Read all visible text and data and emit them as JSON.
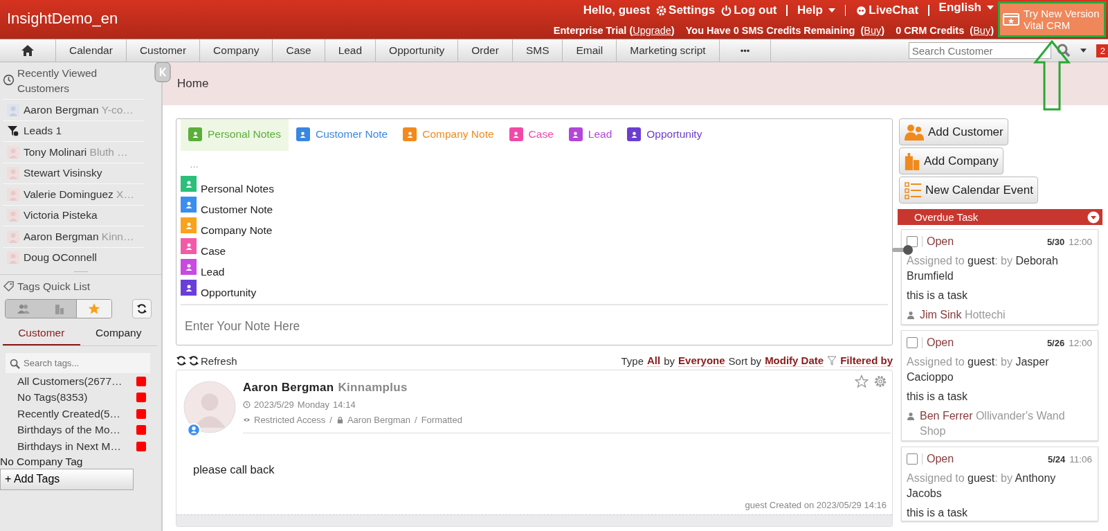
{
  "header": {
    "brand": "InsightDemo_en",
    "greeting": "Hello, guest",
    "settings": "Settings",
    "logout": "Log out",
    "help": "Help",
    "livechat": "LiveChat",
    "language": "English",
    "trial_segments": [
      {
        "kind": "text",
        "text": "Enterprise Trial ("
      },
      {
        "kind": "link",
        "text": "Upgrade"
      },
      {
        "kind": "text",
        "text": ")"
      }
    ],
    "sms_segments": [
      {
        "kind": "text",
        "text": "You Have 0 SMS Credits Remaining"
      },
      {
        "kind": "text",
        "text": "("
      },
      {
        "kind": "link",
        "text": "Buy"
      },
      {
        "kind": "text",
        "text": ")"
      }
    ],
    "crm_segments": [
      {
        "kind": "text",
        "text": "0 CRM Credits"
      },
      {
        "kind": "text",
        "text": "("
      },
      {
        "kind": "link",
        "text": "Buy"
      },
      {
        "kind": "text",
        "text": ")"
      }
    ],
    "try_button": {
      "line1": "Try New Version",
      "line2": "Vital CRM"
    }
  },
  "nav": {
    "items": [
      "Calendar",
      "Customer",
      "Company",
      "Case",
      "Lead",
      "Opportunity",
      "Order",
      "SMS",
      "Email",
      "Marketing script"
    ],
    "more": "•••",
    "search": {
      "placeholder": "Search Customer"
    },
    "badge": "2"
  },
  "sidebar": {
    "recent_title": "Recently Viewed Customers",
    "recent": [
      {
        "kind": "customer",
        "name": "Aaron Bergman",
        "company": "Y-co…"
      },
      {
        "kind": "lead",
        "name": "Leads 1"
      },
      {
        "kind": "customer",
        "name": "Tony Molinari",
        "company": "Bluth …"
      },
      {
        "kind": "customer",
        "name": "Stewart Visinsky"
      },
      {
        "kind": "customer",
        "name": "Valerie Dominguez",
        "company": "X…"
      },
      {
        "kind": "customer",
        "name": "Victoria Pisteka"
      },
      {
        "kind": "customer",
        "name": "Aaron Bergman",
        "company": "Kinn…"
      },
      {
        "kind": "customer",
        "name": "Doug OConnell"
      }
    ],
    "tags_title": "Tags Quick List",
    "tag_types": [
      {
        "kind": "people",
        "selected": false
      },
      {
        "kind": "building",
        "selected": false
      },
      {
        "kind": "star",
        "selected": true
      }
    ],
    "tabs": [
      {
        "label": "Customer",
        "selected": true
      },
      {
        "label": "Company",
        "selected": false
      }
    ],
    "search": {
      "placeholder": "Search tags..."
    },
    "tags": [
      "All Customers(2677…",
      "No Tags(8353)",
      "Recently Created(5…",
      "Birthdays of the Mo…",
      "Birthdays in Next M…"
    ],
    "company_tag": "No Company Tag",
    "add_tags": "+ Add Tags"
  },
  "breadcrumb": "Home",
  "composer": {
    "tabs": [
      {
        "label": "Personal Notes",
        "color": "#5aae3a",
        "selected": true
      },
      {
        "label": "Customer Note",
        "color": "#3a86e0",
        "selected": false
      },
      {
        "label": "Company Note",
        "color": "#f28a1c",
        "selected": false
      },
      {
        "label": "Case",
        "color": "#f04aa8",
        "selected": false
      },
      {
        "label": "Lead",
        "color": "#b446d8",
        "selected": false
      },
      {
        "label": "Opportunity",
        "color": "#6a3ed0",
        "selected": false
      }
    ],
    "menu_more": "…",
    "menu": [
      {
        "label": "Personal Notes",
        "color": "#2bbf7a"
      },
      {
        "label": "Customer Note",
        "color": "#3a8ef0"
      },
      {
        "label": "Company Note",
        "color": "#f9a21c"
      },
      {
        "label": "Case",
        "color": "#f25aa8"
      },
      {
        "label": "Lead",
        "color": "#c84ae0"
      },
      {
        "label": "Opportunity",
        "color": "#6a3ed8"
      }
    ],
    "placeholder": "Enter Your Note Here"
  },
  "toolbar": {
    "refresh": "Refresh",
    "type_label": "Type",
    "type_value": "All",
    "by_label": "by",
    "by_value": "Everyone",
    "sort_label": "Sort by",
    "sort_value": "Modify Date",
    "filter": "Filtered by"
  },
  "note": {
    "name": "Aaron Bergman",
    "company": "Kinnamplus",
    "date": "2023/5/29",
    "day": "Monday",
    "time": "14:14",
    "access": "Restricted Access",
    "owner": "Aaron Bergman",
    "format": "Formatted",
    "separator": "/",
    "body": "please call back",
    "footer": "guest Created on 2023/05/29 14:16"
  },
  "actions": [
    "Add Customer",
    "Add Company",
    "New Calendar Event"
  ],
  "overdue": {
    "title": "Overdue Task",
    "tasks": [
      {
        "checked": false,
        "status": "Open",
        "date": "5/30",
        "time": "12:00",
        "assigned": "Assigned to",
        "assignee": "guest",
        "by": ": by",
        "creator": "Deborah Brumfield",
        "text": "this is a task",
        "contact": "Jim Sink",
        "company": "Hottechi"
      },
      {
        "checked": false,
        "status": "Open",
        "date": "5/26",
        "time": "12:00",
        "assigned": "Assigned to",
        "assignee": "guest",
        "by": ": by",
        "creator": "Jasper Cacioppo",
        "text": "this is a task",
        "contact": "Ben Ferrer",
        "company": "Ollivander's Wand Shop"
      },
      {
        "checked": false,
        "status": "Open",
        "date": "5/24",
        "time": "11:06",
        "assigned": "Assigned to",
        "assignee": "guest",
        "by": ": by",
        "creator": "Anthony Jacobs",
        "text": "this is a task"
      }
    ]
  }
}
